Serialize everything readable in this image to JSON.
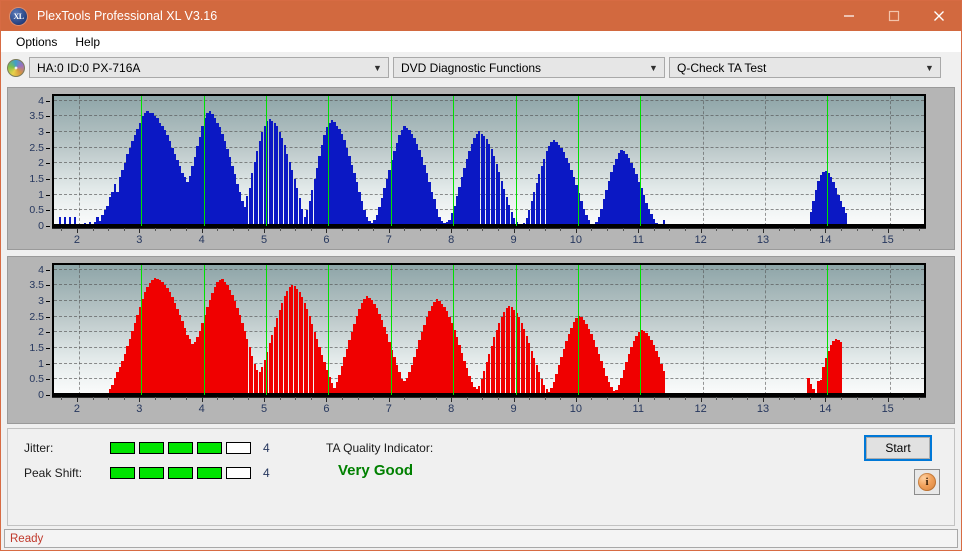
{
  "window": {
    "title": "PlexTools Professional XL V3.16",
    "app_icon": "XL",
    "minimize": "minimize-icon",
    "maximize": "maximize-icon",
    "close": "close-icon"
  },
  "menubar": {
    "items": [
      "Options",
      "Help"
    ]
  },
  "toolbar": {
    "drive_icon": "disc-icon",
    "drive_select": {
      "value": "HA:0 ID:0  PX-716A"
    },
    "function_select": {
      "value": "DVD Diagnostic Functions"
    },
    "test_select": {
      "value": "Q-Check TA Test"
    }
  },
  "status": {
    "jitter_label": "Jitter:",
    "jitter_value": "4",
    "jitter_segments_total": 5,
    "jitter_segments_filled": 4,
    "peak_shift_label": "Peak Shift:",
    "peak_shift_value": "4",
    "peak_shift_segments_total": 5,
    "peak_shift_segments_filled": 4,
    "ta_quality_label": "TA Quality Indicator:",
    "ta_quality_value": "Very Good",
    "start_button": "Start",
    "info_button": "info-icon",
    "statusbar_text": "Ready"
  },
  "colors": {
    "titlebar": "#d2693f",
    "jitter_bar": "#0b18c4",
    "peak_shift_bar": "#f00000",
    "marker": "#00e000",
    "quality_text": "#008000",
    "status_text": "#c0392b",
    "meter_fill": "#00e400",
    "focus_outline": "#0078d7"
  },
  "chart_data": [
    {
      "type": "bar",
      "title": "Jitter",
      "color": "#0b18c4",
      "xlabel": "",
      "ylabel": "",
      "xlim": [
        1.6,
        15.55
      ],
      "ylim": [
        0,
        4.15
      ],
      "yticks": [
        0,
        0.5,
        1,
        1.5,
        2,
        2.5,
        3,
        3.5,
        4
      ],
      "ytick_labels": [
        "0",
        "0.5",
        "1",
        "1.5",
        "2",
        "2.5",
        "3",
        "3.5",
        "4"
      ],
      "xticks": [
        2,
        3,
        4,
        5,
        6,
        7,
        8,
        9,
        10,
        11,
        12,
        13,
        14,
        15
      ],
      "xtick_labels": [
        "2",
        "3",
        "4",
        "5",
        "6",
        "7",
        "8",
        "9",
        "10",
        "11",
        "12",
        "13",
        "14",
        "15"
      ],
      "markers": [
        3,
        4,
        5,
        6,
        7,
        8,
        9,
        10,
        11,
        14
      ],
      "grid": true,
      "bar_width_x": 0.0378,
      "x": [
        1.7,
        1.74,
        1.78,
        1.82,
        1.86,
        1.9,
        1.94,
        1.98,
        2.02,
        2.06,
        2.1,
        2.14,
        2.18,
        2.22,
        2.26,
        2.3,
        2.34,
        2.38,
        2.42,
        2.46,
        2.5,
        2.54,
        2.58,
        2.62,
        2.66,
        2.7,
        2.74,
        2.78,
        2.82,
        2.86,
        2.9,
        2.94,
        2.98,
        3.02,
        3.06,
        3.1,
        3.14,
        3.18,
        3.22,
        3.26,
        3.3,
        3.34,
        3.38,
        3.42,
        3.46,
        3.5,
        3.54,
        3.58,
        3.62,
        3.66,
        3.7,
        3.74,
        3.78,
        3.82,
        3.86,
        3.9,
        3.94,
        3.98,
        4.02,
        4.06,
        4.1,
        4.14,
        4.18,
        4.22,
        4.26,
        4.3,
        4.34,
        4.38,
        4.42,
        4.46,
        4.5,
        4.54,
        4.58,
        4.62,
        4.66,
        4.7,
        4.74,
        4.78,
        4.82,
        4.86,
        4.9,
        4.94,
        4.98,
        5.02,
        5.06,
        5.1,
        5.14,
        5.18,
        5.22,
        5.26,
        5.3,
        5.34,
        5.38,
        5.42,
        5.46,
        5.5,
        5.54,
        5.58,
        5.62,
        5.66,
        5.7,
        5.74,
        5.78,
        5.82,
        5.86,
        5.9,
        5.94,
        5.98,
        6.02,
        6.06,
        6.1,
        6.14,
        6.18,
        6.22,
        6.26,
        6.3,
        6.34,
        6.38,
        6.42,
        6.46,
        6.5,
        6.54,
        6.58,
        6.62,
        6.66,
        6.7,
        6.74,
        6.78,
        6.82,
        6.86,
        6.9,
        6.94,
        6.98,
        7.02,
        7.06,
        7.1,
        7.14,
        7.18,
        7.22,
        7.26,
        7.3,
        7.34,
        7.38,
        7.42,
        7.46,
        7.5,
        7.54,
        7.58,
        7.62,
        7.66,
        7.7,
        7.74,
        7.78,
        7.82,
        7.86,
        7.9,
        7.94,
        7.98,
        8.02,
        8.06,
        8.1,
        8.14,
        8.18,
        8.22,
        8.26,
        8.3,
        8.34,
        8.38,
        8.42,
        8.46,
        8.5,
        8.54,
        8.58,
        8.62,
        8.66,
        8.7,
        8.74,
        8.78,
        8.82,
        8.86,
        8.9,
        8.94,
        8.98,
        9.02,
        9.06,
        9.1,
        9.14,
        9.18,
        9.22,
        9.26,
        9.3,
        9.34,
        9.38,
        9.42,
        9.46,
        9.5,
        9.54,
        9.58,
        9.62,
        9.66,
        9.7,
        9.74,
        9.78,
        9.82,
        9.86,
        9.9,
        9.94,
        9.98,
        10.02,
        10.06,
        10.1,
        10.14,
        10.18,
        10.22,
        10.26,
        10.3,
        10.34,
        10.38,
        10.42,
        10.46,
        10.5,
        10.54,
        10.58,
        10.62,
        10.66,
        10.7,
        10.74,
        10.78,
        10.82,
        10.86,
        10.9,
        10.94,
        10.98,
        11.02,
        11.06,
        11.1,
        11.14,
        11.18,
        11.22,
        11.26,
        11.3,
        11.34,
        11.38,
        13.74,
        13.78,
        13.82,
        13.86,
        13.9,
        13.94,
        13.98,
        14.02,
        14.06,
        14.1,
        14.14,
        14.18,
        14.22,
        14.26,
        14.3
      ],
      "values": [
        0.3,
        0.07,
        0.3,
        0.07,
        0.3,
        0.07,
        0.3,
        0.05,
        0.03,
        0.04,
        0.1,
        0.05,
        0.12,
        0.05,
        0.12,
        0.3,
        0.15,
        0.35,
        0.5,
        0.65,
        0.92,
        1.1,
        1.35,
        1.1,
        1.55,
        1.8,
        2.0,
        2.3,
        2.5,
        2.7,
        2.9,
        3.1,
        3.3,
        3.5,
        3.62,
        3.68,
        3.6,
        3.62,
        3.5,
        3.45,
        3.3,
        3.2,
        3.05,
        2.9,
        2.7,
        2.5,
        2.3,
        2.1,
        1.9,
        1.7,
        1.55,
        1.4,
        1.6,
        1.9,
        2.2,
        2.55,
        2.85,
        3.2,
        3.45,
        3.6,
        3.66,
        3.58,
        3.45,
        3.3,
        3.15,
        2.95,
        2.7,
        2.45,
        2.2,
        1.9,
        1.65,
        1.35,
        1.1,
        0.8,
        0.6,
        0.95,
        1.2,
        1.7,
        2.05,
        2.4,
        2.7,
        3.0,
        3.2,
        3.35,
        3.42,
        3.35,
        3.3,
        3.2,
        3.0,
        2.8,
        2.6,
        2.3,
        2.05,
        1.8,
        1.5,
        1.2,
        0.9,
        0.55,
        0.3,
        0.5,
        0.8,
        1.15,
        1.5,
        1.85,
        2.25,
        2.6,
        2.9,
        3.15,
        3.3,
        3.38,
        3.32,
        3.2,
        3.1,
        2.95,
        2.75,
        2.5,
        2.25,
        1.95,
        1.7,
        1.4,
        1.1,
        0.8,
        0.5,
        0.3,
        0.16,
        0.1,
        0.18,
        0.35,
        0.6,
        0.9,
        1.2,
        1.5,
        1.8,
        2.1,
        2.4,
        2.65,
        2.9,
        3.05,
        3.18,
        3.12,
        3.05,
        2.95,
        2.8,
        2.62,
        2.42,
        2.2,
        1.95,
        1.7,
        1.4,
        1.1,
        0.85,
        0.55,
        0.3,
        0.15,
        0.1,
        0.12,
        0.2,
        0.4,
        0.65,
        0.95,
        1.25,
        1.55,
        1.85,
        2.15,
        2.4,
        2.62,
        2.8,
        2.95,
        3.02,
        2.95,
        2.88,
        2.78,
        2.62,
        2.45,
        2.22,
        1.98,
        1.72,
        1.45,
        1.18,
        0.92,
        0.68,
        0.45,
        0.25,
        0.12,
        0.06,
        0.04,
        0.1,
        0.25,
        0.5,
        0.8,
        1.08,
        1.38,
        1.65,
        1.92,
        2.15,
        2.38,
        2.55,
        2.68,
        2.75,
        2.68,
        2.6,
        2.5,
        2.36,
        2.18,
        2.0,
        1.78,
        1.55,
        1.3,
        1.05,
        0.8,
        0.55,
        0.35,
        0.18,
        0.08,
        0.04,
        0.12,
        0.3,
        0.55,
        0.85,
        1.15,
        1.45,
        1.72,
        1.95,
        2.15,
        2.32,
        2.42,
        2.38,
        2.3,
        2.18,
        2.02,
        1.85,
        1.65,
        1.42,
        1.2,
        0.98,
        0.75,
        0.55,
        0.38,
        0.22,
        0.1,
        0.05,
        0.08,
        0.2,
        0.45,
        0.8,
        1.15,
        1.45,
        1.62,
        1.72,
        1.76,
        1.7,
        1.58,
        1.4,
        1.22,
        1.0,
        0.8,
        0.6,
        0.42,
        0.22,
        0.08,
        0.1,
        0.32,
        0.55,
        0.78,
        1.0,
        1.2,
        1.42,
        1.6,
        1.7,
        1.76,
        1.72,
        1.6,
        1.42,
        1.2,
        0.95,
        0.7,
        0.42,
        0.18
      ]
    },
    {
      "type": "bar",
      "title": "Peak Shift",
      "color": "#f00000",
      "xlabel": "",
      "ylabel": "",
      "xlim": [
        1.6,
        15.55
      ],
      "ylim": [
        0,
        4.15
      ],
      "yticks": [
        0,
        0.5,
        1,
        1.5,
        2,
        2.5,
        3,
        3.5,
        4
      ],
      "ytick_labels": [
        "0",
        "0.5",
        "1",
        "1.5",
        "2",
        "2.5",
        "3",
        "3.5",
        "4"
      ],
      "xticks": [
        2,
        3,
        4,
        5,
        6,
        7,
        8,
        9,
        10,
        11,
        12,
        13,
        14,
        15
      ],
      "xtick_labels": [
        "2",
        "3",
        "4",
        "5",
        "6",
        "7",
        "8",
        "9",
        "10",
        "11",
        "12",
        "13",
        "14",
        "15"
      ],
      "markers": [
        3,
        4,
        5,
        6,
        7,
        8,
        9,
        10,
        11,
        14
      ],
      "grid": true,
      "bar_width_x": 0.0378,
      "x": [
        2.46,
        2.5,
        2.54,
        2.58,
        2.62,
        2.66,
        2.7,
        2.74,
        2.78,
        2.82,
        2.86,
        2.9,
        2.94,
        2.98,
        3.02,
        3.06,
        3.1,
        3.14,
        3.18,
        3.22,
        3.26,
        3.3,
        3.34,
        3.38,
        3.42,
        3.46,
        3.5,
        3.54,
        3.58,
        3.62,
        3.66,
        3.7,
        3.74,
        3.78,
        3.82,
        3.86,
        3.9,
        3.94,
        3.98,
        4.02,
        4.06,
        4.1,
        4.14,
        4.18,
        4.22,
        4.26,
        4.3,
        4.34,
        4.38,
        4.42,
        4.46,
        4.5,
        4.54,
        4.58,
        4.62,
        4.66,
        4.7,
        4.74,
        4.78,
        4.82,
        4.86,
        4.9,
        4.94,
        4.98,
        5.02,
        5.06,
        5.1,
        5.14,
        5.18,
        5.22,
        5.26,
        5.3,
        5.34,
        5.38,
        5.42,
        5.46,
        5.5,
        5.54,
        5.58,
        5.62,
        5.66,
        5.7,
        5.74,
        5.78,
        5.82,
        5.86,
        5.9,
        5.94,
        5.98,
        6.02,
        6.06,
        6.1,
        6.14,
        6.18,
        6.22,
        6.26,
        6.3,
        6.34,
        6.38,
        6.42,
        6.46,
        6.5,
        6.54,
        6.58,
        6.62,
        6.66,
        6.7,
        6.74,
        6.78,
        6.82,
        6.86,
        6.9,
        6.94,
        6.98,
        7.02,
        7.06,
        7.1,
        7.14,
        7.18,
        7.22,
        7.26,
        7.3,
        7.34,
        7.38,
        7.42,
        7.46,
        7.5,
        7.54,
        7.58,
        7.62,
        7.66,
        7.7,
        7.74,
        7.78,
        7.82,
        7.86,
        7.9,
        7.94,
        7.98,
        8.02,
        8.06,
        8.1,
        8.14,
        8.18,
        8.22,
        8.26,
        8.3,
        8.34,
        8.38,
        8.42,
        8.46,
        8.5,
        8.54,
        8.58,
        8.62,
        8.66,
        8.7,
        8.74,
        8.78,
        8.82,
        8.86,
        8.9,
        8.94,
        8.98,
        9.02,
        9.06,
        9.1,
        9.14,
        9.18,
        9.22,
        9.26,
        9.3,
        9.34,
        9.38,
        9.42,
        9.46,
        9.5,
        9.54,
        9.58,
        9.62,
        9.66,
        9.7,
        9.74,
        9.78,
        9.82,
        9.86,
        9.9,
        9.94,
        9.98,
        10.02,
        10.06,
        10.1,
        10.14,
        10.18,
        10.22,
        10.26,
        10.3,
        10.34,
        10.38,
        10.42,
        10.46,
        10.5,
        10.54,
        10.58,
        10.62,
        10.66,
        10.7,
        10.74,
        10.78,
        10.82,
        10.86,
        10.9,
        10.94,
        10.98,
        11.02,
        11.06,
        11.1,
        11.14,
        11.18,
        11.22,
        11.26,
        11.3,
        11.34,
        11.38,
        13.7,
        13.74,
        13.78,
        13.82,
        13.86,
        13.9,
        13.94,
        13.98,
        14.02,
        14.06,
        14.1,
        14.14,
        14.18,
        14.22
      ],
      "values": [
        0.05,
        0.2,
        0.32,
        0.55,
        0.72,
        0.9,
        1.1,
        1.32,
        1.55,
        1.8,
        2.05,
        2.3,
        2.55,
        2.8,
        3.05,
        3.3,
        3.45,
        3.58,
        3.66,
        3.72,
        3.7,
        3.66,
        3.6,
        3.52,
        3.42,
        3.28,
        3.12,
        2.95,
        2.75,
        2.55,
        2.35,
        2.15,
        1.92,
        1.78,
        1.62,
        1.7,
        1.85,
        2.05,
        2.3,
        2.55,
        2.8,
        3.02,
        3.25,
        3.45,
        3.6,
        3.68,
        3.7,
        3.62,
        3.5,
        3.35,
        3.18,
        3.0,
        2.78,
        2.55,
        2.3,
        2.05,
        1.78,
        1.52,
        1.25,
        0.98,
        0.8,
        0.75,
        0.88,
        1.12,
        1.38,
        1.65,
        1.92,
        2.18,
        2.45,
        2.7,
        2.95,
        3.15,
        3.32,
        3.45,
        3.52,
        3.48,
        3.4,
        3.28,
        3.12,
        2.95,
        2.75,
        2.52,
        2.28,
        2.02,
        1.78,
        1.52,
        1.28,
        1.05,
        0.8,
        0.58,
        0.38,
        0.22,
        0.4,
        0.65,
        0.92,
        1.2,
        1.48,
        1.75,
        2.02,
        2.28,
        2.52,
        2.75,
        2.95,
        3.08,
        3.15,
        3.1,
        3.02,
        2.92,
        2.78,
        2.6,
        2.4,
        2.18,
        1.95,
        1.7,
        1.45,
        1.2,
        0.95,
        0.72,
        0.5,
        0.45,
        0.55,
        0.72,
        0.95,
        1.2,
        1.48,
        1.75,
        2.0,
        2.25,
        2.48,
        2.68,
        2.85,
        2.98,
        3.05,
        3.0,
        2.92,
        2.82,
        2.68,
        2.5,
        2.3,
        2.08,
        1.85,
        1.6,
        1.35,
        1.1,
        0.85,
        0.62,
        0.42,
        0.25,
        0.18,
        0.3,
        0.52,
        0.78,
        1.05,
        1.32,
        1.58,
        1.85,
        2.08,
        2.3,
        2.5,
        2.65,
        2.78,
        2.85,
        2.8,
        2.72,
        2.62,
        2.48,
        2.3,
        2.1,
        1.88,
        1.65,
        1.42,
        1.18,
        0.95,
        0.72,
        0.5,
        0.32,
        0.18,
        0.1,
        0.22,
        0.42,
        0.68,
        0.95,
        1.22,
        1.48,
        1.72,
        1.95,
        2.15,
        2.32,
        2.45,
        2.52,
        2.48,
        2.4,
        2.28,
        2.12,
        1.95,
        1.75,
        1.52,
        1.3,
        1.08,
        0.85,
        0.62,
        0.42,
        0.25,
        0.12,
        0.15,
        0.32,
        0.55,
        0.8,
        1.05,
        1.3,
        1.52,
        1.72,
        1.88,
        2.0,
        2.08,
        2.05,
        1.98,
        1.88,
        1.75,
        1.6,
        1.42,
        1.22,
        1.0,
        0.78,
        0.55,
        0.35,
        0.18,
        0.08,
        0.45,
        0.48,
        0.9,
        1.18,
        1.42,
        1.6,
        1.72,
        1.78,
        1.75,
        1.68,
        1.55,
        1.38,
        1.15,
        0.88,
        0.58,
        0.3
      ]
    }
  ]
}
